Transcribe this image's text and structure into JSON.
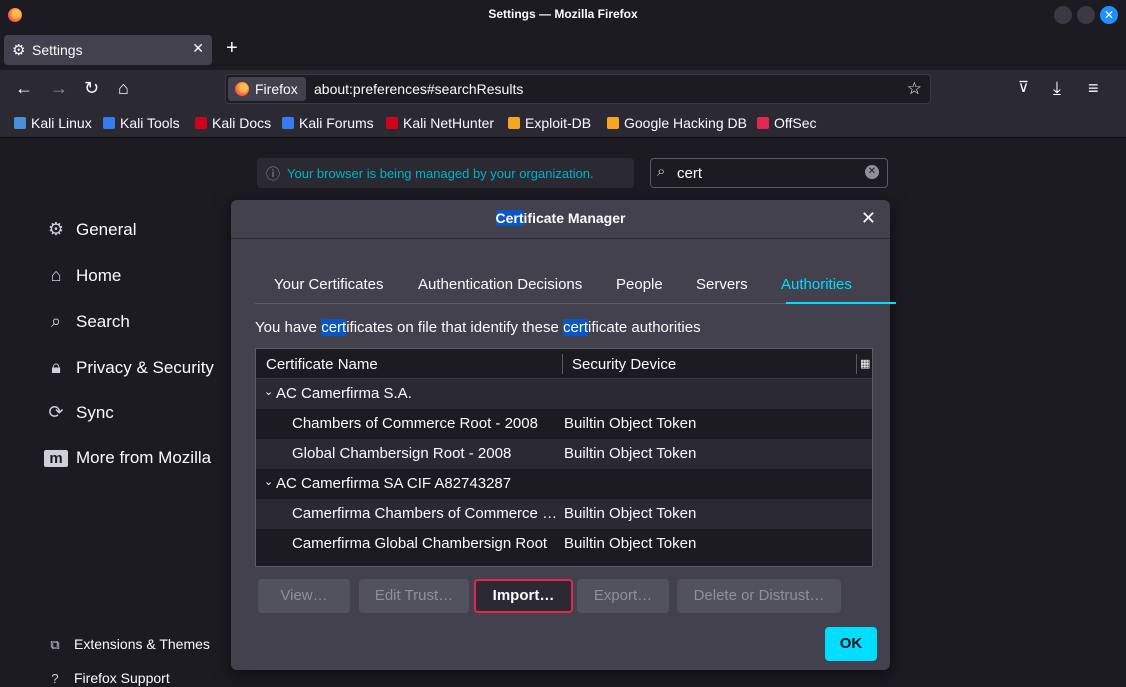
{
  "window": {
    "title": "Settings — Mozilla Firefox"
  },
  "tab": {
    "label": "Settings"
  },
  "urlbar": {
    "identity": "Firefox",
    "url": "about:preferences#searchResults"
  },
  "bookmarks": [
    {
      "label": "Kali Linux",
      "color": "#4a90d9"
    },
    {
      "label": "Kali Tools",
      "color": "#367bf0"
    },
    {
      "label": "Kali Docs",
      "color": "#d0021b"
    },
    {
      "label": "Kali Forums",
      "color": "#367bf0"
    },
    {
      "label": "Kali NetHunter",
      "color": "#d0021b"
    },
    {
      "label": "Exploit-DB",
      "color": "#f5a623"
    },
    {
      "label": "Google Hacking DB",
      "color": "#f5a623"
    },
    {
      "label": "OffSec",
      "color": "#e22850"
    }
  ],
  "notice": "Your browser is being managed by your organization.",
  "search": {
    "value": "cert"
  },
  "categories": [
    "General",
    "Home",
    "Search",
    "Privacy & Security",
    "Sync",
    "More from Mozilla"
  ],
  "footer": [
    "Extensions & Themes",
    "Firefox Support"
  ],
  "dialog": {
    "title_hl": "Cert",
    "title_rest": "ificate Manager",
    "tabs": [
      "Your Certificates",
      "Authentication Decisions",
      "People",
      "Servers",
      "Authorities"
    ],
    "desc": {
      "p1": "You have ",
      "h1": "cert",
      "p2": "ificates on file that identify these ",
      "h2": "cert",
      "p3": "ificate authorities"
    },
    "columns": [
      "Certificate Name",
      "Security Device"
    ],
    "rows": [
      {
        "name": "AC Camerfirma S.A.",
        "device": "",
        "group": true
      },
      {
        "name": "Chambers of Commerce Root - 2008",
        "device": "Builtin Object Token",
        "group": false
      },
      {
        "name": "Global Chambersign Root - 2008",
        "device": "Builtin Object Token",
        "group": false
      },
      {
        "name": "AC Camerfirma SA CIF A82743287",
        "device": "",
        "group": true
      },
      {
        "name": "Camerfirma Chambers of Commerce R…",
        "device": "Builtin Object Token",
        "group": false
      },
      {
        "name": "Camerfirma Global Chambersign Root",
        "device": "Builtin Object Token",
        "group": false
      }
    ],
    "buttons": {
      "view": "View…",
      "edit_trust": "Edit Trust…",
      "import": "Import…",
      "export": "Export…",
      "delete": "Delete or Distrust…",
      "ok": "OK"
    }
  }
}
